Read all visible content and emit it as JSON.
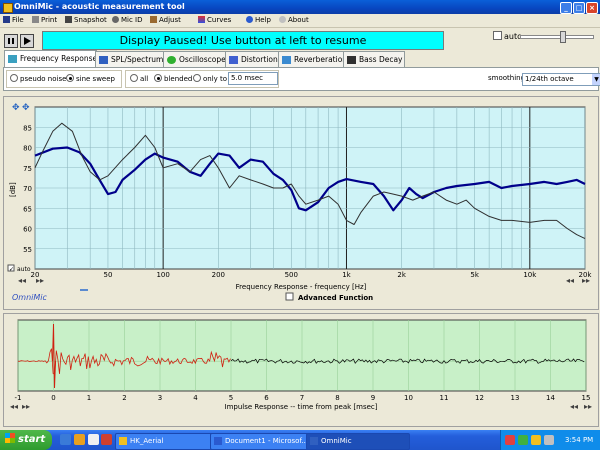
{
  "window": {
    "title": "OmniMic - acoustic measurement tool",
    "controls": [
      "_",
      "□",
      "×"
    ]
  },
  "menu": [
    {
      "label": "File",
      "icon": "save-icon"
    },
    {
      "label": "Print",
      "icon": "printer-icon"
    },
    {
      "label": "Snapshot",
      "icon": "camera-icon"
    },
    {
      "label": "Mic ID",
      "icon": "microphone-icon"
    },
    {
      "label": "Adjust",
      "icon": "wrench-icon"
    },
    {
      "label": "Curves",
      "icon": "curves-icon"
    },
    {
      "label": "Help",
      "icon": "help-icon"
    },
    {
      "label": "About",
      "icon": "about-icon"
    }
  ],
  "toolbar": {
    "pause_icon": "pause-icon",
    "play_icon": "play-icon",
    "banner": "Display Paused! Use button at left to resume",
    "auto_label": "auto",
    "auto_checked": false,
    "slider_level": 0.6
  },
  "tabs": [
    {
      "label": "Frequency Response",
      "icon": "frequency-icon",
      "active": true
    },
    {
      "label": "SPL/Spectrum",
      "icon": "spectrum-icon"
    },
    {
      "label": "Oscilloscope",
      "icon": "oscilloscope-icon"
    },
    {
      "label": "Distortion",
      "icon": "distortion-icon"
    },
    {
      "label": "Reverberation",
      "icon": "reverberation-icon"
    },
    {
      "label": "Bass Decay",
      "icon": "bass-decay-icon"
    }
  ],
  "options": {
    "signal": [
      "pseudo noise",
      "sine sweep"
    ],
    "signal_selected": "sine sweep",
    "window": [
      "all",
      "blended",
      "only to"
    ],
    "window_selected": "blended",
    "msec_value": "5.0 msec",
    "smoothing_label": "smoothing",
    "smoothing_value": "1/24th octave"
  },
  "freq_chart": {
    "auto_label": "auto",
    "brand": "OmniMic",
    "advanced_label": "Advanced Function",
    "xlabel": "Frequency Response  - frequency [Hz]",
    "ylabel": "[dB]"
  },
  "impulse_chart": {
    "xlabel": "Impulse Response  -- time from peak [msec]"
  },
  "chart_data": [
    {
      "type": "line",
      "title": "",
      "xlabel": "Frequency Response  - frequency [Hz]",
      "ylabel": "[dB]",
      "x_scale": "log",
      "xlim": [
        20,
        20000
      ],
      "ylim": [
        50,
        90
      ],
      "x_ticks": [
        {
          "v": 20,
          "t": "20"
        },
        {
          "v": 50,
          "t": "50"
        },
        {
          "v": 100,
          "t": "100"
        },
        {
          "v": 200,
          "t": "200"
        },
        {
          "v": 500,
          "t": "500"
        },
        {
          "v": 1000,
          "t": "1k"
        },
        {
          "v": 2000,
          "t": "2k"
        },
        {
          "v": 5000,
          "t": "5k"
        },
        {
          "v": 10000,
          "t": "10k"
        },
        {
          "v": 20000,
          "t": "20k"
        }
      ],
      "y_ticks": [
        55,
        60,
        65,
        70,
        75,
        80,
        85
      ],
      "grid": true,
      "background": "#cff3f7",
      "series": [
        {
          "color": "#00008b",
          "width": 2.2,
          "points": [
            [
              20,
              78
            ],
            [
              25,
              79.7
            ],
            [
              30,
              80
            ],
            [
              35,
              78.8
            ],
            [
              40,
              76
            ],
            [
              45,
              72
            ],
            [
              50,
              68.5
            ],
            [
              55,
              69
            ],
            [
              60,
              72
            ],
            [
              70,
              74.5
            ],
            [
              80,
              77
            ],
            [
              90,
              78.5
            ],
            [
              100,
              77.5
            ],
            [
              120,
              76.5
            ],
            [
              140,
              74
            ],
            [
              160,
              73
            ],
            [
              180,
              76
            ],
            [
              200,
              78.5
            ],
            [
              230,
              78
            ],
            [
              260,
              75
            ],
            [
              300,
              77
            ],
            [
              350,
              76.5
            ],
            [
              400,
              73.5
            ],
            [
              450,
              72
            ],
            [
              500,
              69.5
            ],
            [
              550,
              65
            ],
            [
              600,
              64.5
            ],
            [
              700,
              66.5
            ],
            [
              800,
              70
            ],
            [
              900,
              71.5
            ],
            [
              1000,
              72.2
            ],
            [
              1200,
              71.5
            ],
            [
              1400,
              71
            ],
            [
              1600,
              68
            ],
            [
              1800,
              64.5
            ],
            [
              2000,
              67
            ],
            [
              2200,
              70
            ],
            [
              2400,
              68.5
            ],
            [
              2600,
              67.5
            ],
            [
              3000,
              69
            ],
            [
              3500,
              70
            ],
            [
              4000,
              70.5
            ],
            [
              5000,
              71
            ],
            [
              6000,
              71.5
            ],
            [
              7000,
              70
            ],
            [
              8000,
              70.5
            ],
            [
              10000,
              71
            ],
            [
              12000,
              71.5
            ],
            [
              14000,
              71
            ],
            [
              16000,
              71.5
            ],
            [
              18000,
              72
            ],
            [
              20000,
              71
            ]
          ]
        },
        {
          "color": "#303030",
          "width": 1,
          "points": [
            [
              20,
              75
            ],
            [
              22,
              79
            ],
            [
              25,
              84
            ],
            [
              28,
              86
            ],
            [
              32,
              84
            ],
            [
              36,
              78
            ],
            [
              40,
              74
            ],
            [
              45,
              72
            ],
            [
              50,
              73
            ],
            [
              60,
              77
            ],
            [
              70,
              80
            ],
            [
              80,
              83
            ],
            [
              90,
              80
            ],
            [
              100,
              75
            ],
            [
              120,
              76
            ],
            [
              140,
              74
            ],
            [
              160,
              77
            ],
            [
              180,
              78
            ],
            [
              200,
              75
            ],
            [
              230,
              70
            ],
            [
              260,
              73
            ],
            [
              300,
              72
            ],
            [
              350,
              71
            ],
            [
              400,
              70
            ],
            [
              450,
              70
            ],
            [
              500,
              71
            ],
            [
              550,
              68
            ],
            [
              600,
              66
            ],
            [
              700,
              67
            ],
            [
              800,
              68
            ],
            [
              900,
              66
            ],
            [
              1000,
              62
            ],
            [
              1100,
              61
            ],
            [
              1200,
              64
            ],
            [
              1400,
              68
            ],
            [
              1600,
              69
            ],
            [
              1800,
              68.5
            ],
            [
              2000,
              68
            ],
            [
              2300,
              67
            ],
            [
              2600,
              68
            ],
            [
              3000,
              69
            ],
            [
              3500,
              67
            ],
            [
              4000,
              66
            ],
            [
              4500,
              67
            ],
            [
              5000,
              65
            ],
            [
              6000,
              63
            ],
            [
              7000,
              62
            ],
            [
              8000,
              62
            ],
            [
              10000,
              61.5
            ],
            [
              12000,
              62
            ],
            [
              14000,
              62
            ],
            [
              16000,
              60
            ],
            [
              18000,
              58.5
            ],
            [
              20000,
              57.5
            ]
          ]
        }
      ]
    },
    {
      "type": "line",
      "title": "",
      "xlabel": "Impulse Response  -- time from peak [msec]",
      "xlim": [
        -1,
        15
      ],
      "x_ticks": [
        -1,
        0,
        1,
        2,
        3,
        4,
        5,
        6,
        7,
        8,
        9,
        10,
        11,
        12,
        13,
        14,
        15
      ],
      "grid": true,
      "background": "#c8f0c8",
      "series": [
        {
          "name": "",
          "color": "#d02010",
          "x_range": [
            -1,
            5
          ]
        },
        {
          "name": "",
          "color": "#000000",
          "x_range": [
            5,
            15
          ]
        }
      ]
    }
  ],
  "taskbar": {
    "start_label": "start",
    "tasks": [
      {
        "label": "HK_Aerial",
        "icon": "folder-icon"
      },
      {
        "label": "Document1 - Microsof...",
        "icon": "word-icon"
      },
      {
        "label": "OmniMic",
        "icon": "omnimic-icon",
        "active": true
      }
    ],
    "clock": "3:54 PM"
  }
}
